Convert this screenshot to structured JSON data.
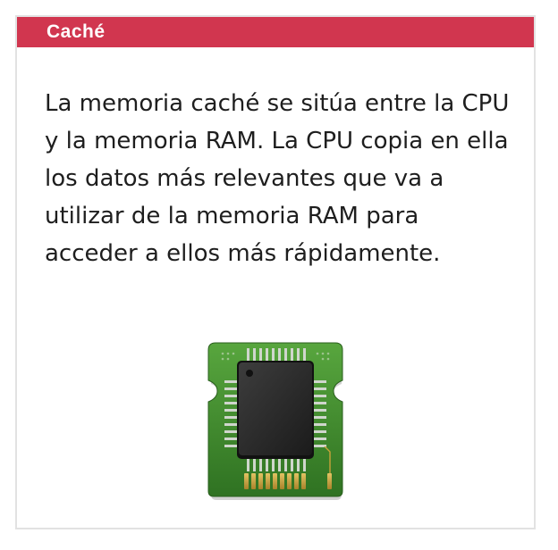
{
  "card": {
    "title": "Caché",
    "text": "La memoria caché se sitúa entre la CPU y la memoria RAM. La CPU copia en ella los datos más relevantes que va a utilizar de la memoria RAM para acceder a ellos más rápidamente."
  },
  "image": {
    "icon": "memory-chip-icon"
  },
  "colors": {
    "header": "#d1364f",
    "border": "#e2e2e2",
    "text": "#1e1e1e",
    "board": "#3f8a2e",
    "chip": "#2c2c2c",
    "contacts": "#c9a23a"
  }
}
